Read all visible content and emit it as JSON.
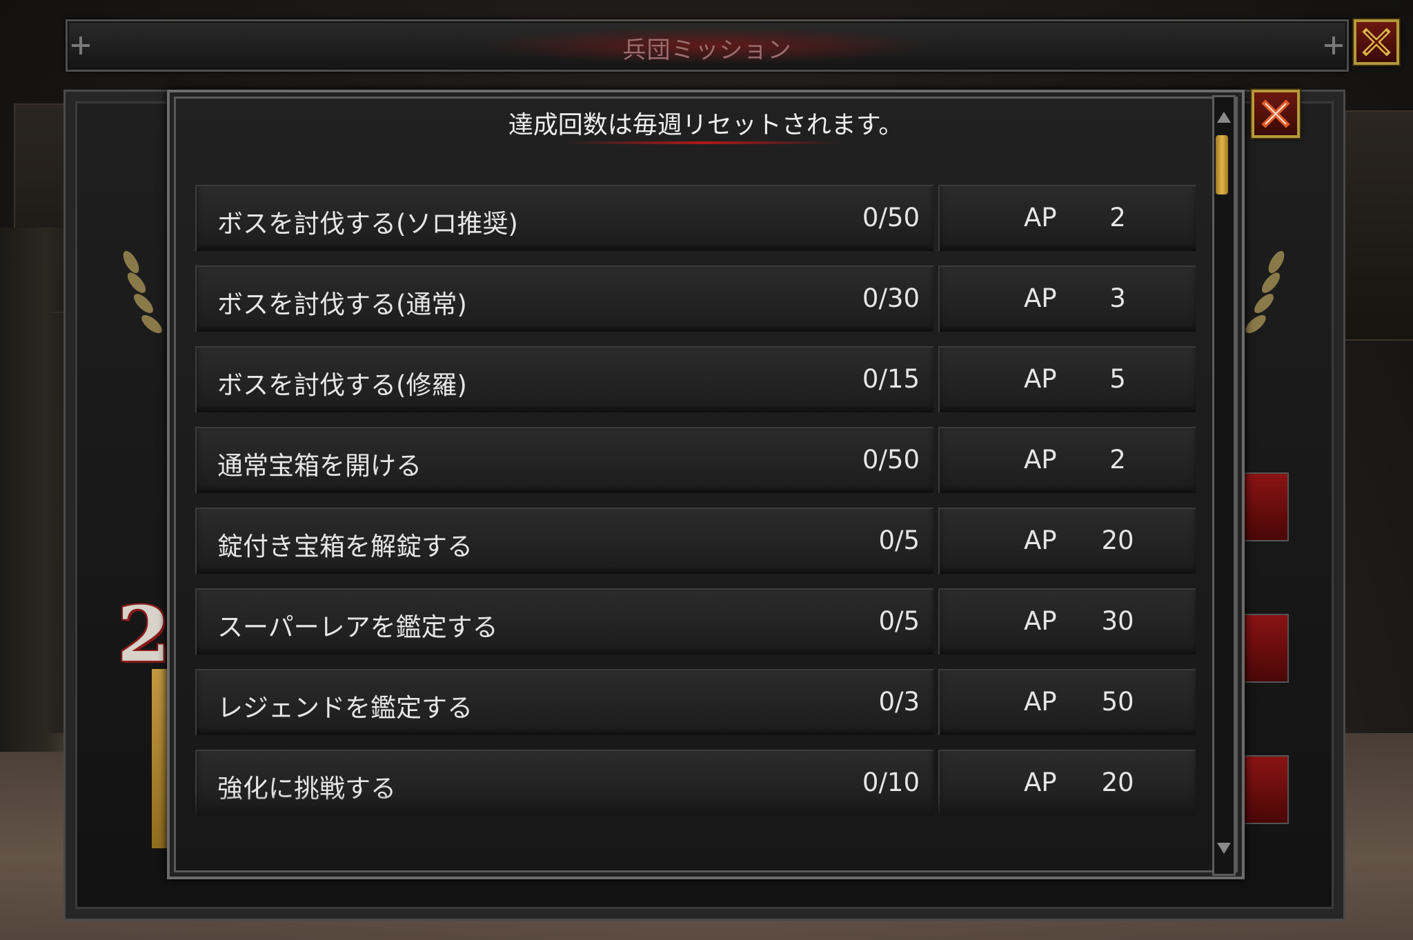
{
  "window": {
    "title": "兵団ミッション"
  },
  "dialog": {
    "header": "達成回数は毎週リセットされます。"
  },
  "background": {
    "rank_number": "2"
  },
  "missions": [
    {
      "name": "ボスを討伐する(ソロ推奨)",
      "progress": "0/50",
      "ap_label": "AP",
      "ap_value": "2"
    },
    {
      "name": "ボスを討伐する(通常)",
      "progress": "0/30",
      "ap_label": "AP",
      "ap_value": "3"
    },
    {
      "name": "ボスを討伐する(修羅)",
      "progress": "0/15",
      "ap_label": "AP",
      "ap_value": "5"
    },
    {
      "name": "通常宝箱を開ける",
      "progress": "0/50",
      "ap_label": "AP",
      "ap_value": "2"
    },
    {
      "name": "錠付き宝箱を解錠する",
      "progress": "0/5",
      "ap_label": "AP",
      "ap_value": "20"
    },
    {
      "name": "スーパーレアを鑑定する",
      "progress": "0/5",
      "ap_label": "AP",
      "ap_value": "30"
    },
    {
      "name": "レジェンドを鑑定する",
      "progress": "0/3",
      "ap_label": "AP",
      "ap_value": "50"
    },
    {
      "name": "強化に挑戦する",
      "progress": "0/10",
      "ap_label": "AP",
      "ap_value": "20"
    }
  ],
  "icons": {
    "outer_close": "close-icon",
    "dialog_close": "close-icon",
    "scroll_up": "arrow-up-icon",
    "scroll_down": "arrow-down-icon",
    "laurel": "laurel-icon"
  },
  "colors": {
    "accent_red": "#b01818",
    "gold": "#b39a3b"
  }
}
